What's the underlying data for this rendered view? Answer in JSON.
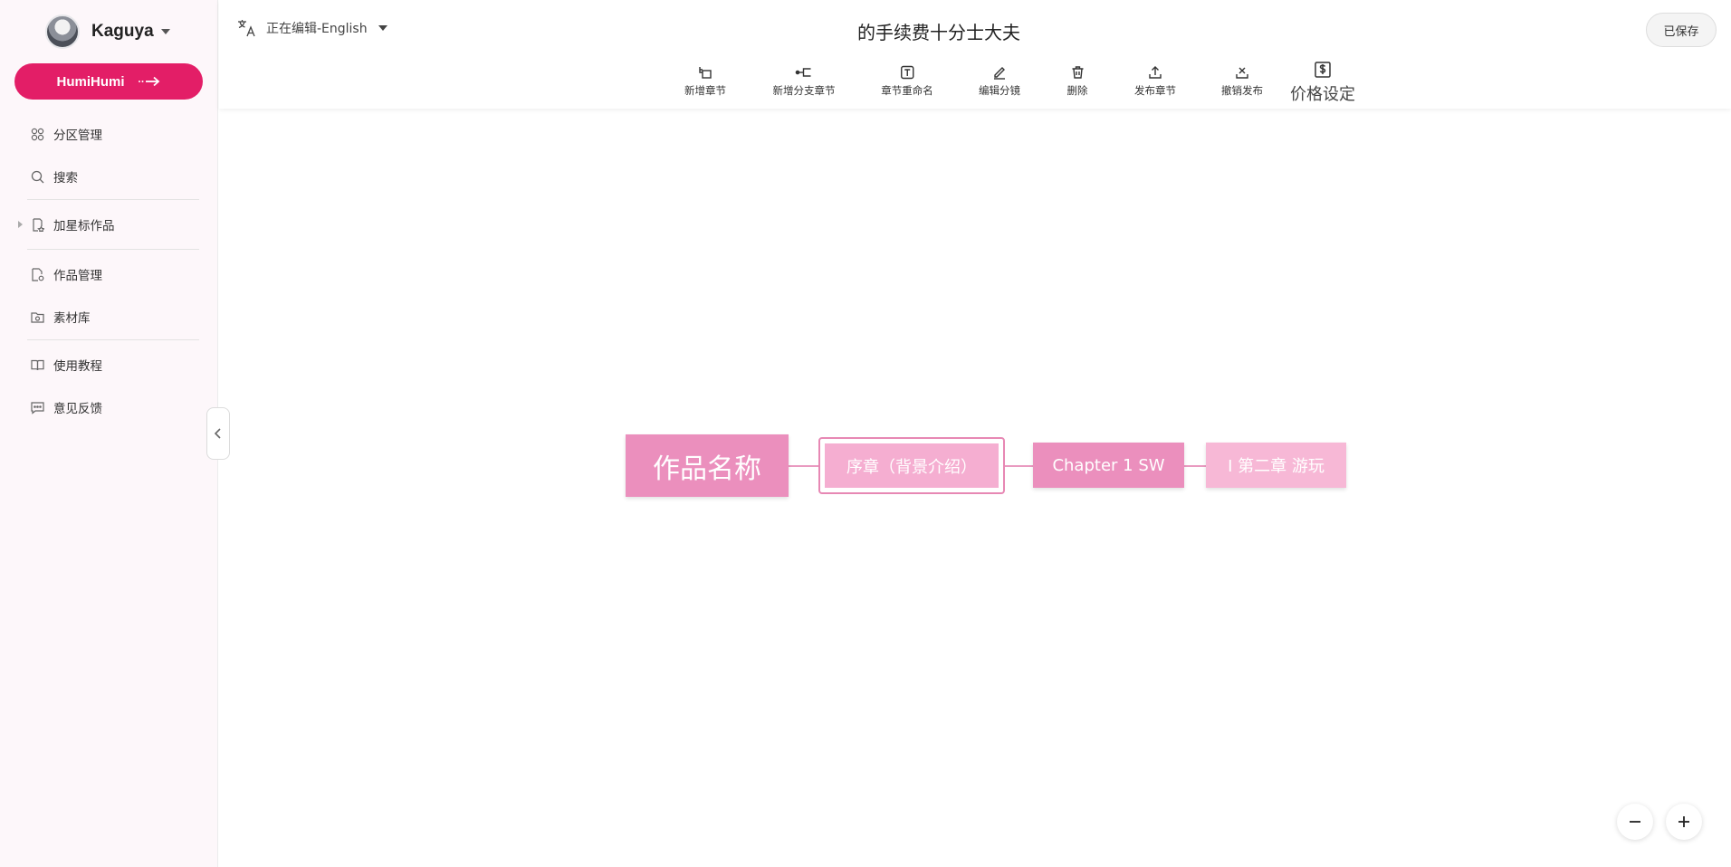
{
  "user": {
    "name": "Kaguya"
  },
  "sidebar": {
    "cta_label": "HumiHumi",
    "items": [
      {
        "label": "分区管理",
        "icon": "grid-icon"
      },
      {
        "label": "搜索",
        "icon": "search-icon"
      },
      {
        "label": "加星标作品",
        "icon": "star-doc-icon"
      },
      {
        "label": "作品管理",
        "icon": "doc-settings-icon"
      },
      {
        "label": "素材库",
        "icon": "folder-icon"
      },
      {
        "label": "使用教程",
        "icon": "book-icon"
      },
      {
        "label": "意见反馈",
        "icon": "message-icon"
      }
    ]
  },
  "header": {
    "language_label": "正在编辑-English",
    "title": "的手续费十分士大夫",
    "saved_label": "已保存",
    "toolbar": [
      {
        "label": "新增章节",
        "icon": "add-chapter-icon"
      },
      {
        "label": "新增分支章节",
        "icon": "add-branch-icon"
      },
      {
        "label": "章节重命名",
        "icon": "rename-icon"
      },
      {
        "label": "编辑分镜",
        "icon": "edit-icon"
      },
      {
        "label": "删除",
        "icon": "trash-icon"
      },
      {
        "label": "发布章节",
        "icon": "upload-icon"
      },
      {
        "label": "撤销发布",
        "icon": "unpublish-icon"
      },
      {
        "label": "价格设定",
        "icon": "price-icon"
      }
    ]
  },
  "canvas": {
    "nodes": [
      {
        "label": "作品名称"
      },
      {
        "label": "序章（背景介绍）"
      },
      {
        "label": "Chapter 1 SW"
      },
      {
        "label": "I 第二章 游玩"
      }
    ]
  },
  "colors": {
    "brand": "#e31e67",
    "node_dark": "#eb8fbd",
    "node_light": "#f5aed1"
  }
}
